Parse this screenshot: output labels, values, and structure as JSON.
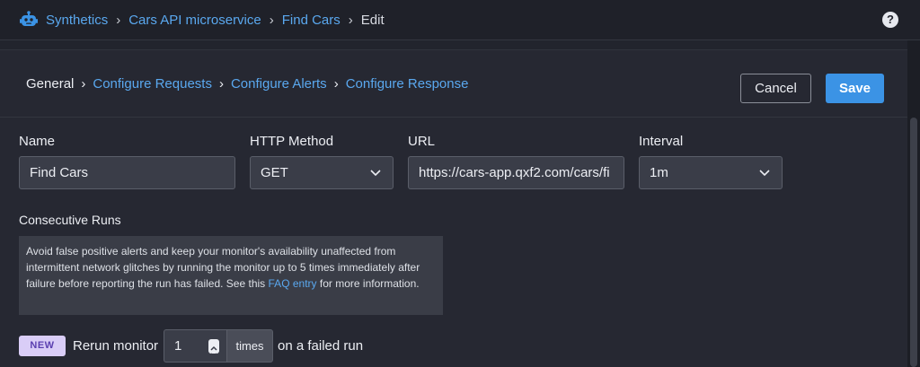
{
  "breadcrumb": {
    "items": [
      "Synthetics",
      "Cars API microservice",
      "Find Cars"
    ],
    "current": "Edit"
  },
  "help_icon": "question-circle-icon",
  "steps": [
    "General",
    "Configure Requests",
    "Configure Alerts",
    "Configure Response"
  ],
  "actions": {
    "cancel": "Cancel",
    "save": "Save"
  },
  "form": {
    "name": {
      "label": "Name",
      "value": "Find Cars"
    },
    "http_method": {
      "label": "HTTP Method",
      "value": "GET"
    },
    "url": {
      "label": "URL",
      "value": "https://cars-app.qxf2.com/cars/fi"
    },
    "interval": {
      "label": "Interval",
      "value": "1m"
    }
  },
  "consecutive_runs": {
    "title": "Consecutive Runs",
    "description_before": "Avoid false positive alerts and keep your monitor's availability unaffected from intermittent network glitches by running the monitor up to 5 times immediately after failure before reporting the run has failed. See this",
    "link_text": "FAQ entry",
    "description_after": "for more information.",
    "badge": "NEW",
    "rerun_label": "Rerun monitor",
    "rerun_value": "1",
    "unit": "times",
    "suffix": "on a failed run"
  },
  "colors": {
    "accent": "#3b93e5",
    "link": "#5aa8ef",
    "badge_bg": "#d9cdf7",
    "background": "#22242d"
  }
}
